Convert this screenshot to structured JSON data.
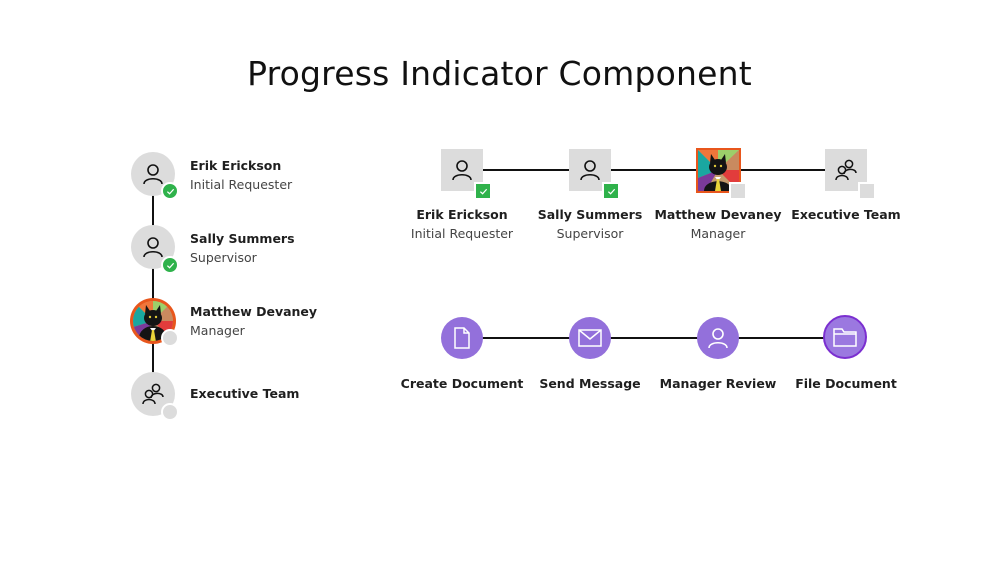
{
  "title": "Progress Indicator Component",
  "colors": {
    "complete_badge": "#2fb24b",
    "pending_badge": "#dcdcdc",
    "step_purple": "#9370db",
    "active_ring": "#7b2fd0",
    "connector": "#111111",
    "avatar_bg": "#dcdcdc"
  },
  "vertical_indicator": {
    "steps": [
      {
        "name": "Erik Erickson",
        "role": "Initial Requester",
        "icon": "person-icon",
        "status": "complete"
      },
      {
        "name": "Sally Summers",
        "role": "Supervisor",
        "icon": "person-icon",
        "status": "complete"
      },
      {
        "name": "Matthew Devaney",
        "role": "Manager",
        "icon": "cat-photo-avatar",
        "status": "pending"
      },
      {
        "name": "Executive Team",
        "role": "",
        "icon": "group-icon",
        "status": "pending"
      }
    ]
  },
  "horizontal_indicator": {
    "steps": [
      {
        "name": "Erik Erickson",
        "role": "Initial Requester",
        "icon": "person-icon",
        "status": "complete"
      },
      {
        "name": "Sally Summers",
        "role": "Supervisor",
        "icon": "person-icon",
        "status": "complete"
      },
      {
        "name": "Matthew Devaney",
        "role": "Manager",
        "icon": "cat-photo-avatar",
        "status": "pending"
      },
      {
        "name": "Executive Team",
        "role": "",
        "icon": "group-icon",
        "status": "pending"
      }
    ]
  },
  "process_indicator": {
    "steps": [
      {
        "label": "Create Document",
        "icon": "document-icon",
        "status": "complete"
      },
      {
        "label": "Send Message",
        "icon": "envelope-icon",
        "status": "complete"
      },
      {
        "label": "Manager Review",
        "icon": "person-icon",
        "status": "complete"
      },
      {
        "label": "File Document",
        "icon": "folder-icon",
        "status": "current"
      }
    ]
  }
}
